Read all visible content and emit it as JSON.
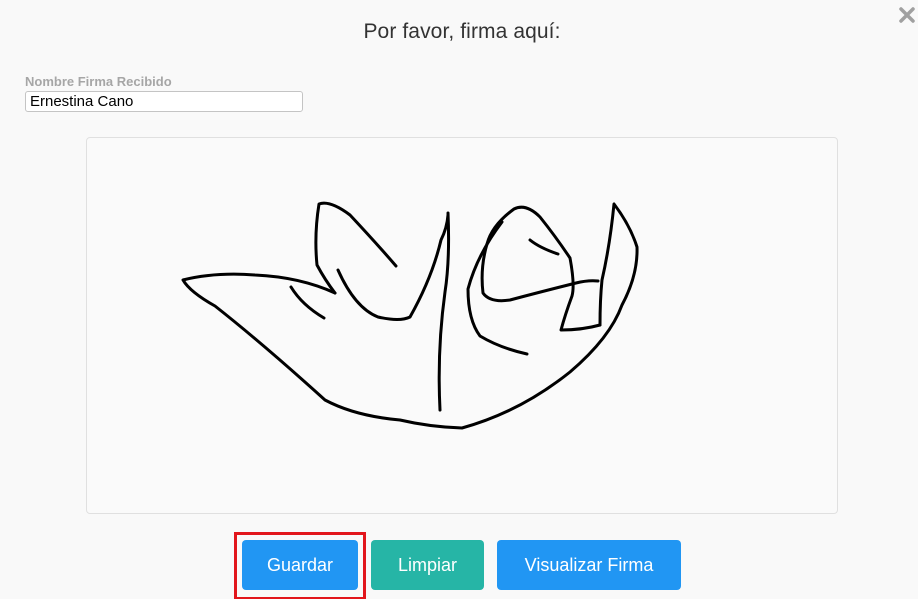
{
  "dialog": {
    "title": "Por favor, firma aquí:",
    "close_icon": "close-icon"
  },
  "form": {
    "name_label": "Nombre Firma Recibido",
    "name_value": "Ernestina Cano"
  },
  "signature_pad": {
    "stroke_color": "#000000",
    "background": "#fafafa"
  },
  "buttons": {
    "save_label": "Guardar",
    "clear_label": "Limpiar",
    "view_label": "Visualizar Firma"
  },
  "colors": {
    "primary": "#2196f3",
    "teal": "#26b5a6",
    "highlight": "#e2161c"
  }
}
